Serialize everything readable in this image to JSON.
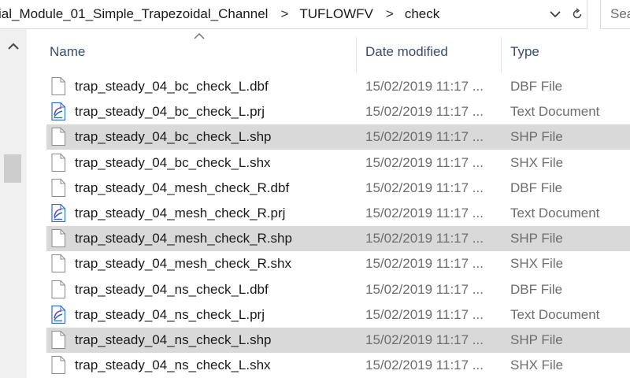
{
  "address_bar": {
    "breadcrumbs": [
      "ial_Module_01_Simple_Trapezoidal_Channel",
      "TUFLOWFV",
      "check"
    ],
    "separator": ">"
  },
  "search": {
    "placeholder": "Sea"
  },
  "columns": {
    "name": "Name",
    "date_modified": "Date modified",
    "type": "Type"
  },
  "files": [
    {
      "name": "trap_steady_04_bc_check_L.dbf",
      "date": "15/02/2019 11:17 ...",
      "type": "DBF File",
      "icon": "blank-file-icon",
      "selected": false
    },
    {
      "name": "trap_steady_04_bc_check_L.prj",
      "date": "15/02/2019 11:17 ...",
      "type": "Text Document",
      "icon": "text-document-icon",
      "selected": false
    },
    {
      "name": "trap_steady_04_bc_check_L.shp",
      "date": "15/02/2019 11:17 ...",
      "type": "SHP File",
      "icon": "blank-file-icon",
      "selected": true
    },
    {
      "name": "trap_steady_04_bc_check_L.shx",
      "date": "15/02/2019 11:17 ...",
      "type": "SHX File",
      "icon": "blank-file-icon",
      "selected": false
    },
    {
      "name": "trap_steady_04_mesh_check_R.dbf",
      "date": "15/02/2019 11:17 ...",
      "type": "DBF File",
      "icon": "blank-file-icon",
      "selected": false
    },
    {
      "name": "trap_steady_04_mesh_check_R.prj",
      "date": "15/02/2019 11:17 ...",
      "type": "Text Document",
      "icon": "text-document-icon",
      "selected": false
    },
    {
      "name": "trap_steady_04_mesh_check_R.shp",
      "date": "15/02/2019 11:17 ...",
      "type": "SHP File",
      "icon": "blank-file-icon",
      "selected": true
    },
    {
      "name": "trap_steady_04_mesh_check_R.shx",
      "date": "15/02/2019 11:17 ...",
      "type": "SHX File",
      "icon": "blank-file-icon",
      "selected": false
    },
    {
      "name": "trap_steady_04_ns_check_L.dbf",
      "date": "15/02/2019 11:17 ...",
      "type": "DBF File",
      "icon": "blank-file-icon",
      "selected": false
    },
    {
      "name": "trap_steady_04_ns_check_L.prj",
      "date": "15/02/2019 11:17 ...",
      "type": "Text Document",
      "icon": "text-document-icon",
      "selected": false
    },
    {
      "name": "trap_steady_04_ns_check_L.shp",
      "date": "15/02/2019 11:17 ...",
      "type": "SHP File",
      "icon": "blank-file-icon",
      "selected": true
    },
    {
      "name": "trap_steady_04_ns_check_L.shx",
      "date": "15/02/2019 11:17 ...",
      "type": "SHX File",
      "icon": "blank-file-icon",
      "selected": false
    }
  ],
  "colors": {
    "selected_row": "#d9d9d9",
    "header_text": "#3b4b6b",
    "secondary_text": "#6d6d6d"
  }
}
